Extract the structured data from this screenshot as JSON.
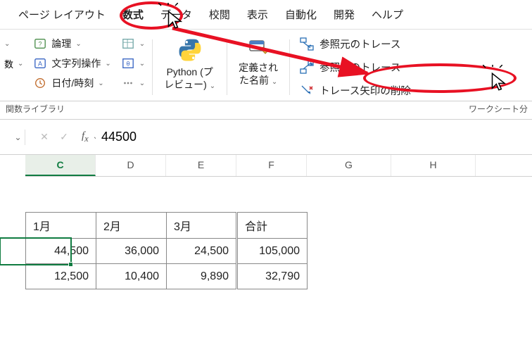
{
  "tabs": {
    "page_layout": "ページ レイアウト",
    "formulas": "数式",
    "data": "データ",
    "review": "校閲",
    "view": "表示",
    "automate": "自動化",
    "developer": "開発",
    "help": "ヘルプ"
  },
  "lib": {
    "func_truncated": "数",
    "logical": "論理",
    "text": "文字列操作",
    "datetime": "日付/時刻",
    "section_label": "関数ライブラリ"
  },
  "python": {
    "line1": "Python (プ",
    "line2": "レビュー)"
  },
  "names": {
    "line1": "定義され",
    "line2": "た名前"
  },
  "trace": {
    "precedents": "参照元のトレース",
    "dependents": "参照先のトレース",
    "remove": "トレース矢印の削除",
    "section_label_truncated": "ワークシート分"
  },
  "formula_bar": {
    "value": "44500"
  },
  "columns": [
    "C",
    "D",
    "E",
    "F",
    "G",
    "H"
  ],
  "selected_column": "C",
  "table": {
    "headers": [
      "1月",
      "2月",
      "3月",
      "合計"
    ],
    "rows": [
      [
        "44,500",
        "36,000",
        "24,500",
        "105,000"
      ],
      [
        "12,500",
        "10,400",
        "9,890",
        "32,790"
      ]
    ]
  }
}
